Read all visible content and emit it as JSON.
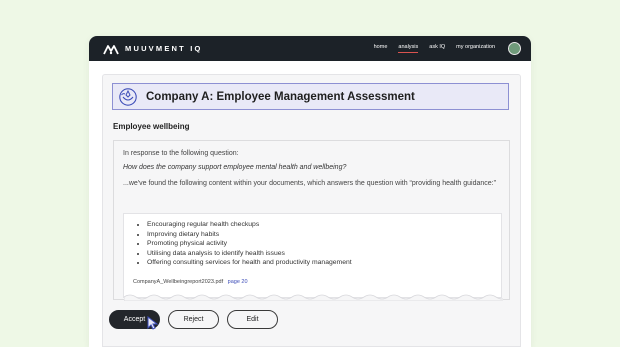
{
  "app": {
    "brand": "MUUVMENT IQ",
    "nav": [
      {
        "label": "home",
        "active": false
      },
      {
        "label": "analysis",
        "active": true
      },
      {
        "label": "ask IQ",
        "active": false
      },
      {
        "label": "my organization",
        "active": false
      }
    ]
  },
  "page": {
    "title": "Company A: Employee Management Assessment",
    "section_title": "Employee wellbeing"
  },
  "answer": {
    "intro": "In response to the following question:",
    "question": "How does the company support employee mental health and wellbeing?",
    "found_text": "...we've found the following content within your documents, which answers the question with “providing health guidance:”",
    "bullets": [
      "Encouraging regular health checkups",
      "Improving dietary habits",
      "Promoting physical activity",
      "Utilising data analysis to identify health issues",
      "Offering consulting services for health and productivity management"
    ],
    "source_file": "CompanyA_Wellbeingreport2023.pdf",
    "source_page": "page 20"
  },
  "actions": {
    "accept": "Accept",
    "reject": "Reject",
    "edit": "Edit"
  },
  "colors": {
    "page_bg": "#eef8e6",
    "topbar": "#1c2228",
    "header_bg": "#e9e9f7",
    "header_border": "#8d90d3",
    "link": "#3d4db8",
    "active_nav_underline": "#d9534f"
  }
}
